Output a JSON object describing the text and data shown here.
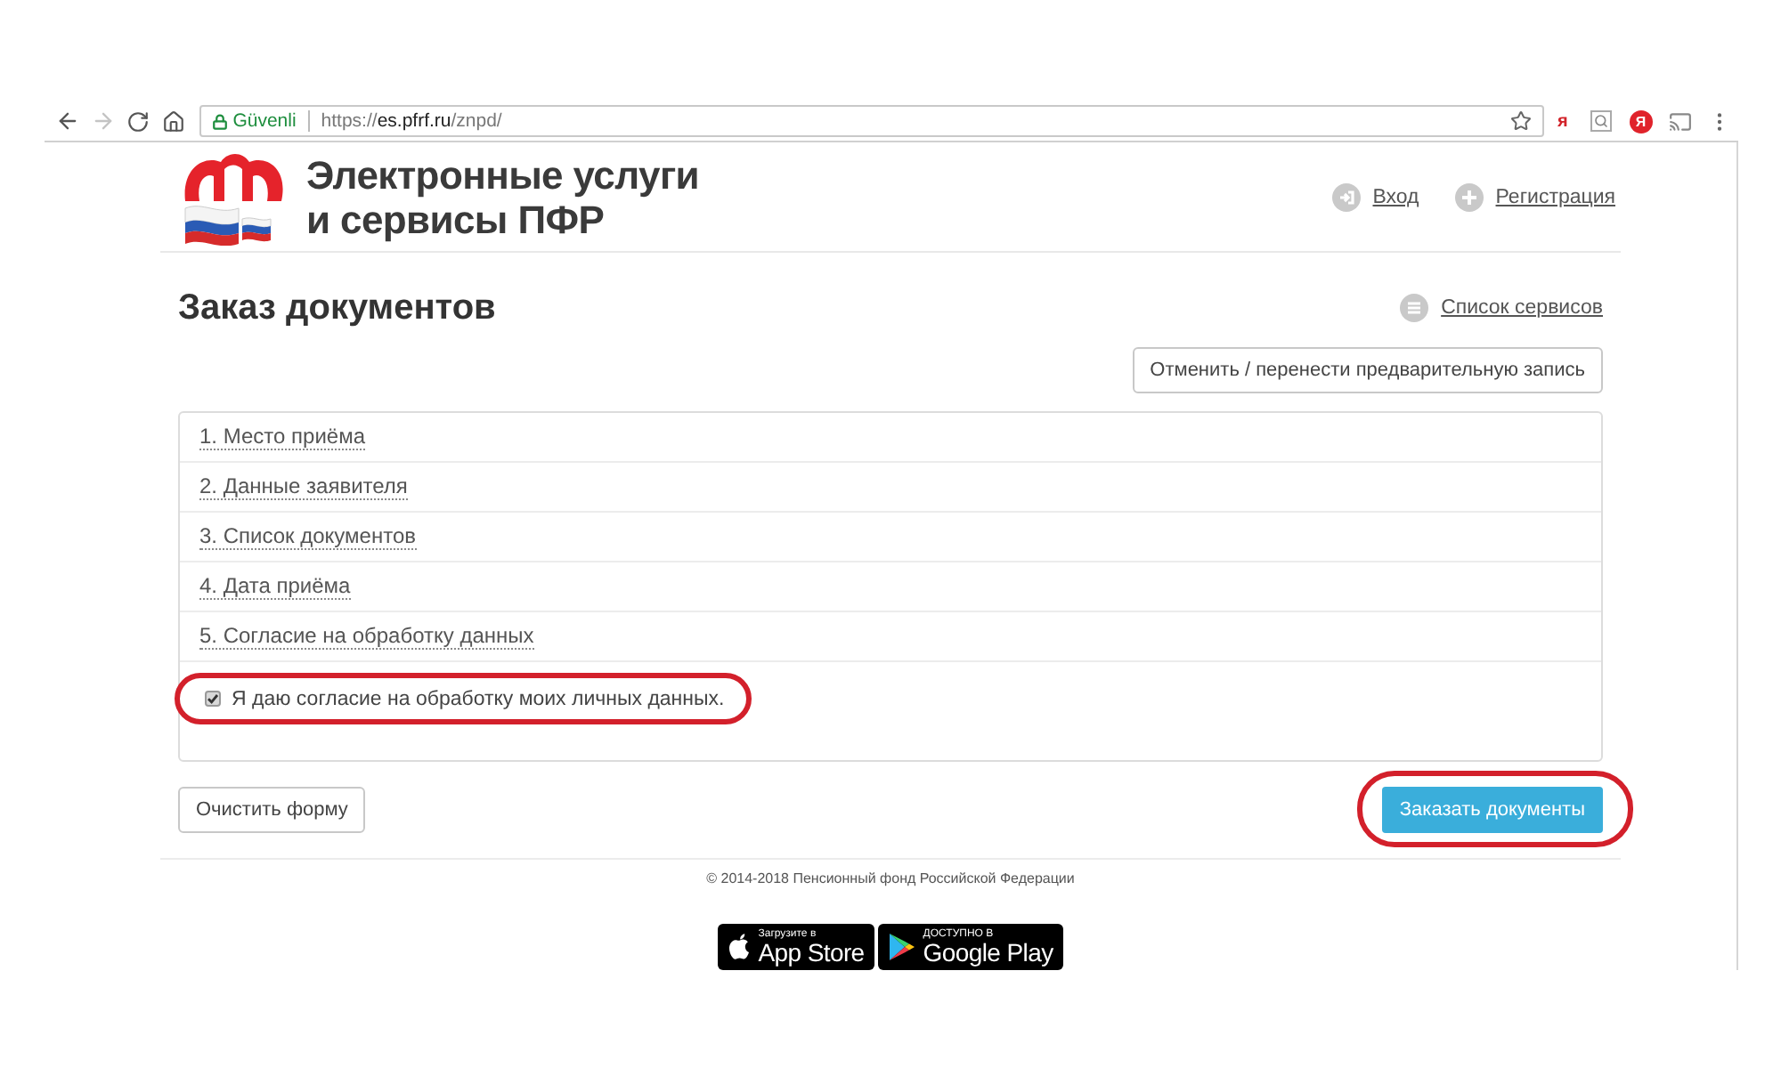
{
  "browser": {
    "security_label": "Güvenli",
    "url": {
      "scheme": "https://",
      "host": "es.pfrf.ru",
      "path": "/znpd/"
    },
    "extensions": [
      {
        "kind": "letter",
        "label": "я"
      },
      {
        "kind": "search"
      },
      {
        "kind": "badge",
        "label": "Я"
      },
      {
        "kind": "cast"
      }
    ]
  },
  "header": {
    "title_lines": [
      "Электронные услуги",
      "и сервисы ПФР"
    ],
    "links": [
      {
        "kind": "login",
        "label": "Вход"
      },
      {
        "kind": "register",
        "label": "Регистрация"
      }
    ]
  },
  "page": {
    "title": "Заказ документов",
    "services_link": "Список сервисов",
    "cancel_button": "Отменить / перенести предварительную запись"
  },
  "steps": [
    {
      "label": "1. Место приёма"
    },
    {
      "label": "2. Данные заявителя"
    },
    {
      "label": "3. Список документов"
    },
    {
      "label": "4. Дата приёма"
    },
    {
      "label": "5. Согласие на обработку данных"
    }
  ],
  "consent": {
    "label": "Я даю согласие на обработку моих личных данных.",
    "checked": true,
    "highlighted": true
  },
  "actions": {
    "clear_button": "Очистить форму",
    "submit_button": {
      "label": "Заказать документы",
      "highlighted": true
    }
  },
  "footer": {
    "copyright": "© 2014-2018 Пенсионный фонд Российской Федерации",
    "store_badges": [
      {
        "kind": "apple",
        "caption": "Загрузите в",
        "store": "App Store"
      },
      {
        "kind": "google",
        "caption": "ДОСТУПНО В",
        "store": "Google Play"
      }
    ]
  }
}
